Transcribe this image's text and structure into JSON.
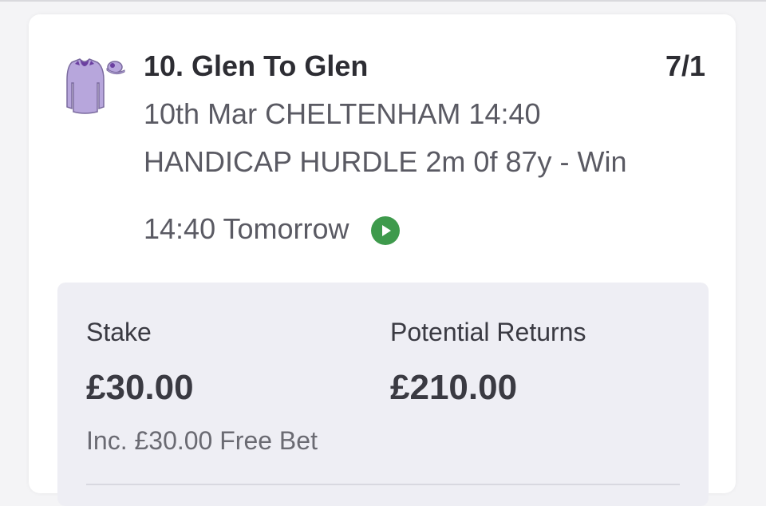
{
  "bet": {
    "selection": "10. Glen To Glen",
    "odds": "7/1",
    "event_line1": "10th Mar CHELTENHAM 14:40",
    "event_line2": "HANDICAP HURDLE 2m 0f 87y - Win",
    "start_time": "14:40 Tomorrow",
    "silks_icon": "jockey-silks-icon",
    "live_icon": "play-circle-icon",
    "silks_color": "#b7a6dc",
    "silks_accent_color": "#6b3fa0",
    "live_icon_color": "#3e9a4c"
  },
  "stake_panel": {
    "stake_label": "Stake",
    "stake_value": "£30.00",
    "free_bet_note": "Inc. £30.00 Free Bet",
    "returns_label": "Potential Returns",
    "returns_value": "£210.00"
  }
}
